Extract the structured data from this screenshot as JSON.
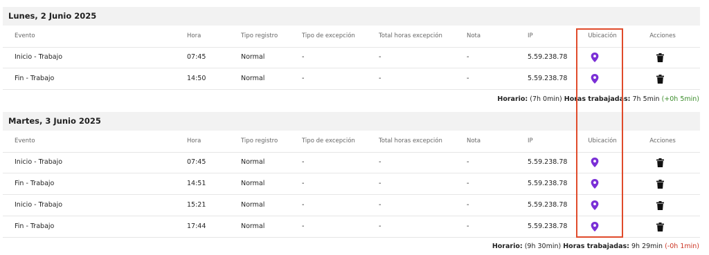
{
  "columns": {
    "evento": "Evento",
    "hora": "Hora",
    "tipo_registro": "Tipo registro",
    "tipo_excepcion": "Tipo de excepción",
    "total_horas_excepcion": "Total horas excepción",
    "nota": "Nota",
    "ip": "IP",
    "ubicacion": "Ubicación",
    "acciones": "Acciones"
  },
  "days": [
    {
      "title": "Lunes, 2 Junio 2025",
      "rows": [
        {
          "evento": "Inicio - Trabajo",
          "hora": "07:45",
          "tipo": "Normal",
          "excepcion": "-",
          "total": "-",
          "nota": "-",
          "ip": "5.59.238.78"
        },
        {
          "evento": "Fin - Trabajo",
          "hora": "14:50",
          "tipo": "Normal",
          "excepcion": "-",
          "total": "-",
          "nota": "-",
          "ip": "5.59.238.78"
        }
      ],
      "summary": {
        "horario_label": "Horario:",
        "horario_value": "(7h 0min)",
        "trabajadas_label": "Horas trabajadas:",
        "trabajadas_value": "7h 5min",
        "diff": "(+0h 5min)",
        "diff_color": "#3a8c2a"
      }
    },
    {
      "title": "Martes, 3 Junio 2025",
      "rows": [
        {
          "evento": "Inicio - Trabajo",
          "hora": "07:45",
          "tipo": "Normal",
          "excepcion": "-",
          "total": "-",
          "nota": "-",
          "ip": "5.59.238.78"
        },
        {
          "evento": "Fin - Trabajo",
          "hora": "14:51",
          "tipo": "Normal",
          "excepcion": "-",
          "total": "-",
          "nota": "-",
          "ip": "5.59.238.78"
        },
        {
          "evento": "Inicio - Trabajo",
          "hora": "15:21",
          "tipo": "Normal",
          "excepcion": "-",
          "total": "-",
          "nota": "-",
          "ip": "5.59.238.78"
        },
        {
          "evento": "Fin - Trabajo",
          "hora": "17:44",
          "tipo": "Normal",
          "excepcion": "-",
          "total": "-",
          "nota": "-",
          "ip": "5.59.238.78"
        }
      ],
      "summary": {
        "horario_label": "Horario:",
        "horario_value": "(9h 30min)",
        "trabajadas_label": "Horas trabajadas:",
        "trabajadas_value": "9h 29min",
        "diff": "(-0h 1min)",
        "diff_color": "#cc3322"
      }
    }
  ],
  "icons": {
    "location": "location-pin-icon",
    "delete": "trash-icon"
  },
  "colors": {
    "pin": "#7a2fd6",
    "highlight_border": "#e04a2a"
  }
}
